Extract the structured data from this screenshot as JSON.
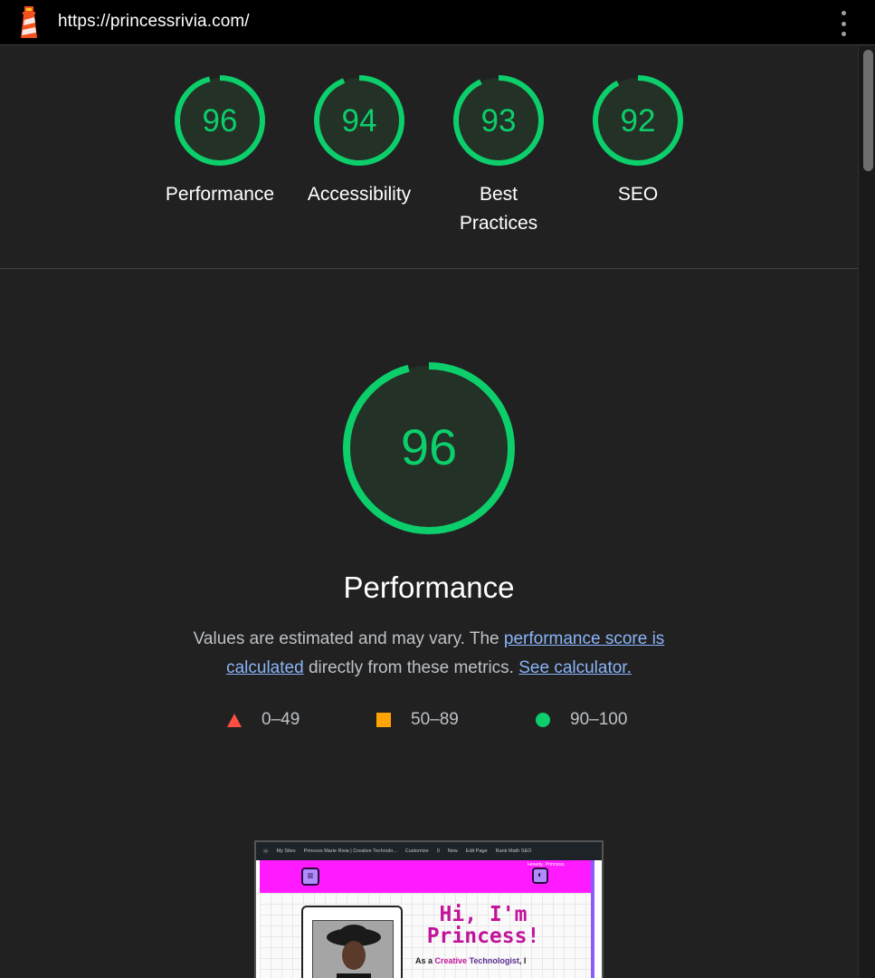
{
  "topbar": {
    "url": "https://princessrivia.com/",
    "logo_icon": "lighthouse-icon",
    "menu_icon": "kebab-menu-icon"
  },
  "colors": {
    "pass": "#0cce6b",
    "average": "#ffa400",
    "fail": "#ff4e42",
    "gauge_fill": "#233126",
    "link": "#8ab4f8"
  },
  "summary_gauges": [
    {
      "score": "96",
      "label": "Performance"
    },
    {
      "score": "94",
      "label": "Accessibility"
    },
    {
      "score": "93",
      "label": "Best Practices"
    },
    {
      "score": "92",
      "label": "SEO"
    }
  ],
  "performance": {
    "score": "96",
    "title": "Performance",
    "desc_prefix": "Values are estimated and may vary. The ",
    "desc_link1": "performance score is calculated",
    "desc_middle": " directly from these metrics. ",
    "desc_link2": "See calculator."
  },
  "legend": [
    {
      "shape": "triangle",
      "range": "0–49"
    },
    {
      "shape": "square",
      "range": "50–89"
    },
    {
      "shape": "circle",
      "range": "90–100"
    }
  ],
  "thumbnail": {
    "admin_bar": [
      "My Sites",
      "Princess Marie Rivia | Creative Technolo...",
      "Customize",
      "0",
      "New",
      "Edit Page",
      "Rank Math SEO"
    ],
    "howdy": "Howdy, Princess",
    "headline": "Hi, I'm Princess!",
    "intro_prefix": "As a ",
    "intro_highlight1": "Creative",
    "intro_highlight2": "Technologist",
    "intro_suffix": ", I"
  }
}
